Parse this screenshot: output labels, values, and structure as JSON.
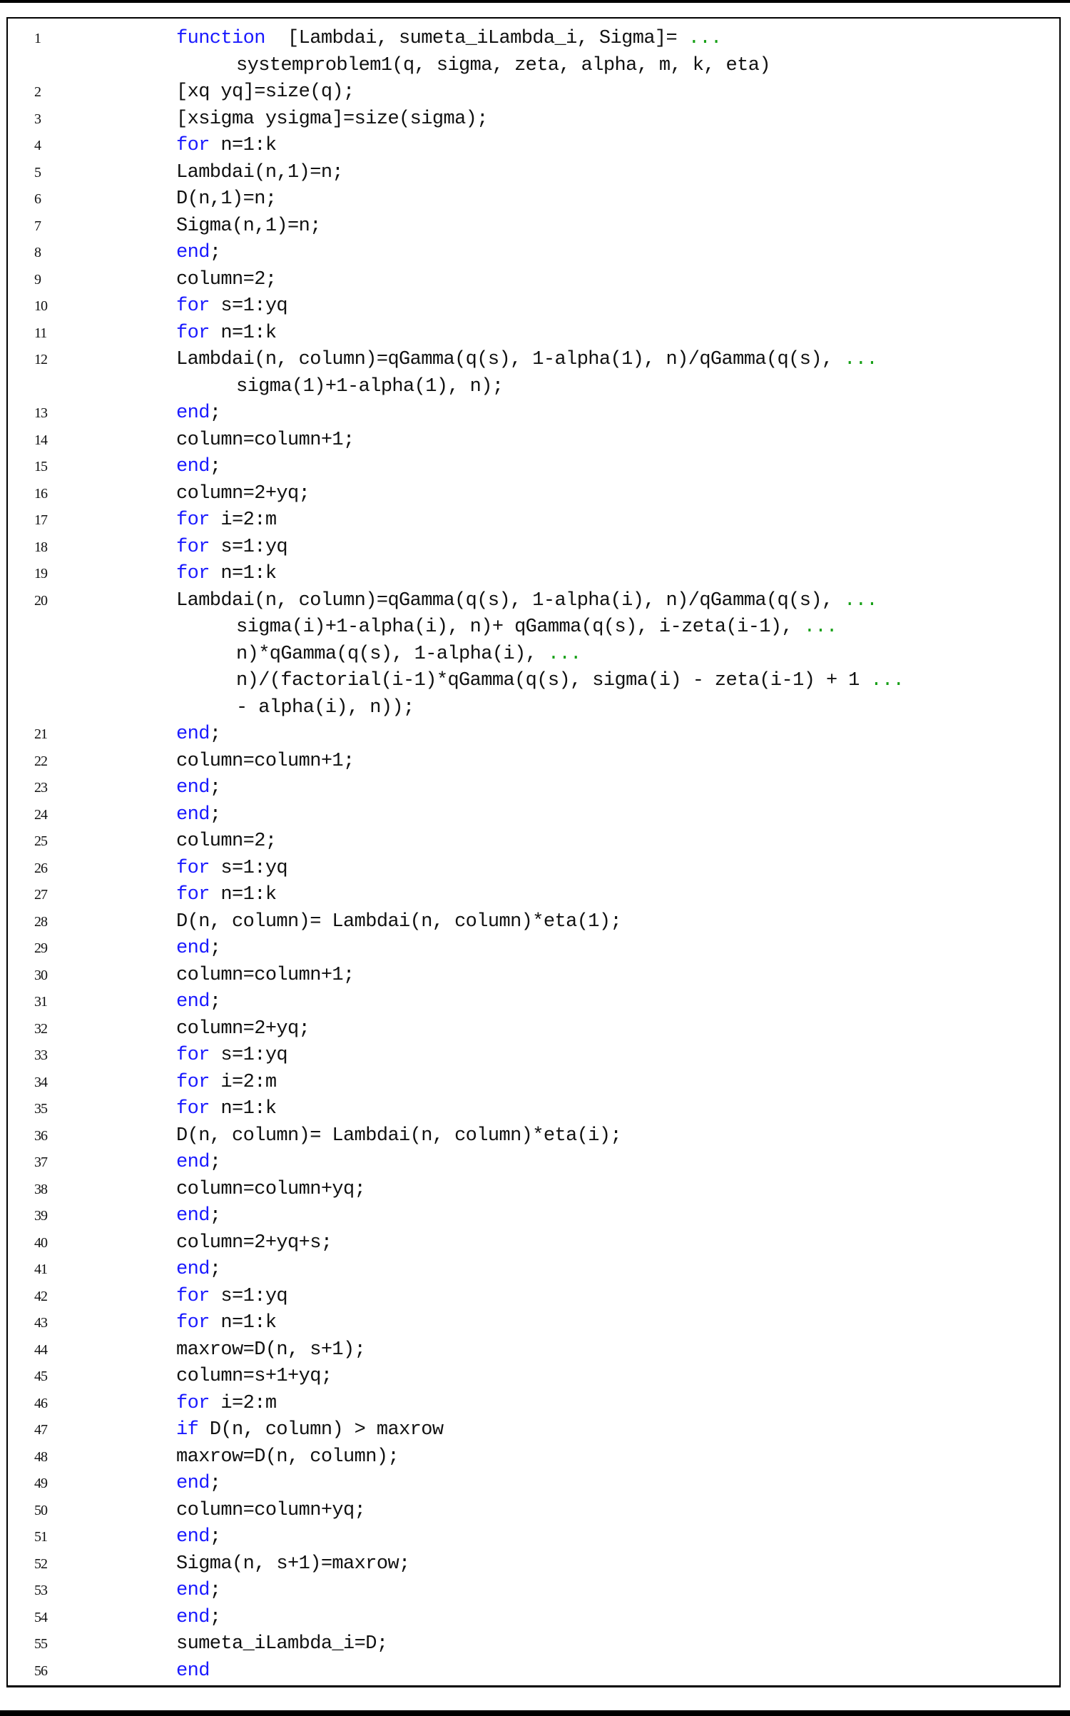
{
  "document": {
    "language": "MATLAB",
    "colors": {
      "keyword": "#1a1aff",
      "continuation": "#17a017",
      "text": "#111111"
    },
    "lines": [
      {
        "n": "1",
        "segs": [
          [
            "kw",
            "function"
          ],
          [
            "t",
            "  [Lambdai, sumeta_iLambda_i, Sigma]= "
          ],
          [
            "e",
            "..."
          ]
        ]
      },
      {
        "n": "",
        "cont": true,
        "segs": [
          [
            "t",
            "systemproblem1(q, sigma, zeta, alpha, m, k, eta)"
          ]
        ]
      },
      {
        "n": "2",
        "segs": [
          [
            "t",
            "[xq yq]=size(q);"
          ]
        ]
      },
      {
        "n": "3",
        "segs": [
          [
            "t",
            "[xsigma ysigma]=size(sigma);"
          ]
        ]
      },
      {
        "n": "4",
        "segs": [
          [
            "kw",
            "for"
          ],
          [
            "t",
            " n=1:k"
          ]
        ]
      },
      {
        "n": "5",
        "segs": [
          [
            "t",
            "Lambdai(n,1)=n;"
          ]
        ]
      },
      {
        "n": "6",
        "segs": [
          [
            "t",
            "D(n,1)=n;"
          ]
        ]
      },
      {
        "n": "7",
        "segs": [
          [
            "t",
            "Sigma(n,1)=n;"
          ]
        ]
      },
      {
        "n": "8",
        "segs": [
          [
            "kw",
            "end"
          ],
          [
            "t",
            ";"
          ]
        ]
      },
      {
        "n": "9",
        "segs": [
          [
            "t",
            "column=2;"
          ]
        ]
      },
      {
        "n": "10",
        "segs": [
          [
            "kw",
            "for"
          ],
          [
            "t",
            " s=1:yq"
          ]
        ]
      },
      {
        "n": "11",
        "segs": [
          [
            "kw",
            "for"
          ],
          [
            "t",
            " n=1:k"
          ]
        ]
      },
      {
        "n": "12",
        "segs": [
          [
            "t",
            "Lambdai(n, column)=qGamma(q(s), 1-alpha(1), n)/qGamma(q(s), "
          ],
          [
            "e",
            "..."
          ]
        ]
      },
      {
        "n": "",
        "cont": true,
        "segs": [
          [
            "t",
            "sigma(1)+1-alpha(1), n);"
          ]
        ]
      },
      {
        "n": "13",
        "segs": [
          [
            "kw",
            "end"
          ],
          [
            "t",
            ";"
          ]
        ]
      },
      {
        "n": "14",
        "segs": [
          [
            "t",
            "column=column+1;"
          ]
        ]
      },
      {
        "n": "15",
        "segs": [
          [
            "kw",
            "end"
          ],
          [
            "t",
            ";"
          ]
        ]
      },
      {
        "n": "16",
        "segs": [
          [
            "t",
            "column=2+yq;"
          ]
        ]
      },
      {
        "n": "17",
        "segs": [
          [
            "kw",
            "for"
          ],
          [
            "t",
            " i=2:m"
          ]
        ]
      },
      {
        "n": "18",
        "segs": [
          [
            "kw",
            "for"
          ],
          [
            "t",
            " s=1:yq"
          ]
        ]
      },
      {
        "n": "19",
        "segs": [
          [
            "kw",
            "for"
          ],
          [
            "t",
            " n=1:k"
          ]
        ]
      },
      {
        "n": "20",
        "segs": [
          [
            "t",
            "Lambdai(n, column)=qGamma(q(s), 1-alpha(i), n)/qGamma(q(s), "
          ],
          [
            "e",
            "..."
          ]
        ]
      },
      {
        "n": "",
        "cont": true,
        "segs": [
          [
            "t",
            "sigma(i)+1-alpha(i), n)+ qGamma(q(s), i-zeta(i-1), "
          ],
          [
            "e",
            "..."
          ]
        ]
      },
      {
        "n": "",
        "cont": true,
        "segs": [
          [
            "t",
            "n)*qGamma(q(s), 1-alpha(i), "
          ],
          [
            "e",
            "..."
          ]
        ]
      },
      {
        "n": "",
        "cont": true,
        "segs": [
          [
            "t",
            "n)/(factorial(i-1)*qGamma(q(s), sigma(i) - zeta(i-1) + 1 "
          ],
          [
            "e",
            "..."
          ]
        ]
      },
      {
        "n": "",
        "cont": true,
        "segs": [
          [
            "t",
            "- alpha(i), n));"
          ]
        ]
      },
      {
        "n": "21",
        "segs": [
          [
            "kw",
            "end"
          ],
          [
            "t",
            ";"
          ]
        ]
      },
      {
        "n": "22",
        "segs": [
          [
            "t",
            "column=column+1;"
          ]
        ]
      },
      {
        "n": "23",
        "segs": [
          [
            "kw",
            "end"
          ],
          [
            "t",
            ";"
          ]
        ]
      },
      {
        "n": "24",
        "segs": [
          [
            "kw",
            "end"
          ],
          [
            "t",
            ";"
          ]
        ]
      },
      {
        "n": "25",
        "segs": [
          [
            "t",
            "column=2;"
          ]
        ]
      },
      {
        "n": "26",
        "segs": [
          [
            "kw",
            "for"
          ],
          [
            "t",
            " s=1:yq"
          ]
        ]
      },
      {
        "n": "27",
        "segs": [
          [
            "kw",
            "for"
          ],
          [
            "t",
            " n=1:k"
          ]
        ]
      },
      {
        "n": "28",
        "segs": [
          [
            "t",
            "D(n, column)= Lambdai(n, column)*eta(1);"
          ]
        ]
      },
      {
        "n": "29",
        "segs": [
          [
            "kw",
            "end"
          ],
          [
            "t",
            ";"
          ]
        ]
      },
      {
        "n": "30",
        "segs": [
          [
            "t",
            "column=column+1;"
          ]
        ]
      },
      {
        "n": "31",
        "segs": [
          [
            "kw",
            "end"
          ],
          [
            "t",
            ";"
          ]
        ]
      },
      {
        "n": "32",
        "segs": [
          [
            "t",
            "column=2+yq;"
          ]
        ]
      },
      {
        "n": "33",
        "segs": [
          [
            "kw",
            "for"
          ],
          [
            "t",
            " s=1:yq"
          ]
        ]
      },
      {
        "n": "34",
        "segs": [
          [
            "kw",
            "for"
          ],
          [
            "t",
            " i=2:m"
          ]
        ]
      },
      {
        "n": "35",
        "segs": [
          [
            "kw",
            "for"
          ],
          [
            "t",
            " n=1:k"
          ]
        ]
      },
      {
        "n": "36",
        "segs": [
          [
            "t",
            "D(n, column)= Lambdai(n, column)*eta(i);"
          ]
        ]
      },
      {
        "n": "37",
        "segs": [
          [
            "kw",
            "end"
          ],
          [
            "t",
            ";"
          ]
        ]
      },
      {
        "n": "38",
        "segs": [
          [
            "t",
            "column=column+yq;"
          ]
        ]
      },
      {
        "n": "39",
        "segs": [
          [
            "kw",
            "end"
          ],
          [
            "t",
            ";"
          ]
        ]
      },
      {
        "n": "40",
        "segs": [
          [
            "t",
            "column=2+yq+s;"
          ]
        ]
      },
      {
        "n": "41",
        "segs": [
          [
            "kw",
            "end"
          ],
          [
            "t",
            ";"
          ]
        ]
      },
      {
        "n": "42",
        "segs": [
          [
            "kw",
            "for"
          ],
          [
            "t",
            " s=1:yq"
          ]
        ]
      },
      {
        "n": "43",
        "segs": [
          [
            "kw",
            "for"
          ],
          [
            "t",
            " n=1:k"
          ]
        ]
      },
      {
        "n": "44",
        "segs": [
          [
            "t",
            "maxrow=D(n, s+1);"
          ]
        ]
      },
      {
        "n": "45",
        "segs": [
          [
            "t",
            "column=s+1+yq;"
          ]
        ]
      },
      {
        "n": "46",
        "segs": [
          [
            "kw",
            "for"
          ],
          [
            "t",
            " i=2:m"
          ]
        ]
      },
      {
        "n": "47",
        "segs": [
          [
            "kw",
            "if"
          ],
          [
            "t",
            " D(n, column) > maxrow"
          ]
        ]
      },
      {
        "n": "48",
        "segs": [
          [
            "t",
            "maxrow=D(n, column);"
          ]
        ]
      },
      {
        "n": "49",
        "segs": [
          [
            "kw",
            "end"
          ],
          [
            "t",
            ";"
          ]
        ]
      },
      {
        "n": "50",
        "segs": [
          [
            "t",
            "column=column+yq;"
          ]
        ]
      },
      {
        "n": "51",
        "segs": [
          [
            "kw",
            "end"
          ],
          [
            "t",
            ";"
          ]
        ]
      },
      {
        "n": "52",
        "segs": [
          [
            "t",
            "Sigma(n, s+1)=maxrow;"
          ]
        ]
      },
      {
        "n": "53",
        "segs": [
          [
            "kw",
            "end"
          ],
          [
            "t",
            ";"
          ]
        ]
      },
      {
        "n": "54",
        "segs": [
          [
            "kw",
            "end"
          ],
          [
            "t",
            ";"
          ]
        ]
      },
      {
        "n": "55",
        "segs": [
          [
            "t",
            "sumeta_iLambda_i=D;"
          ]
        ]
      },
      {
        "n": "56",
        "segs": [
          [
            "kw",
            "end"
          ]
        ]
      }
    ]
  }
}
